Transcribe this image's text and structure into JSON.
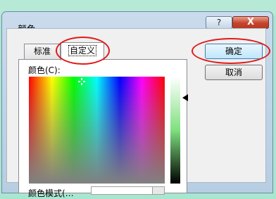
{
  "window": {
    "title": "颜色",
    "help_glyph": "?",
    "close_glyph": "X"
  },
  "tabs": [
    {
      "label": "标准",
      "selected": false
    },
    {
      "label": "自定义",
      "selected": true
    }
  ],
  "buttons": {
    "ok_label": "确定",
    "cancel_label": "取消"
  },
  "custom": {
    "colors_label": "颜色(C):",
    "mode_label": "颜色模式(…"
  },
  "annotation_color": "#e01818"
}
